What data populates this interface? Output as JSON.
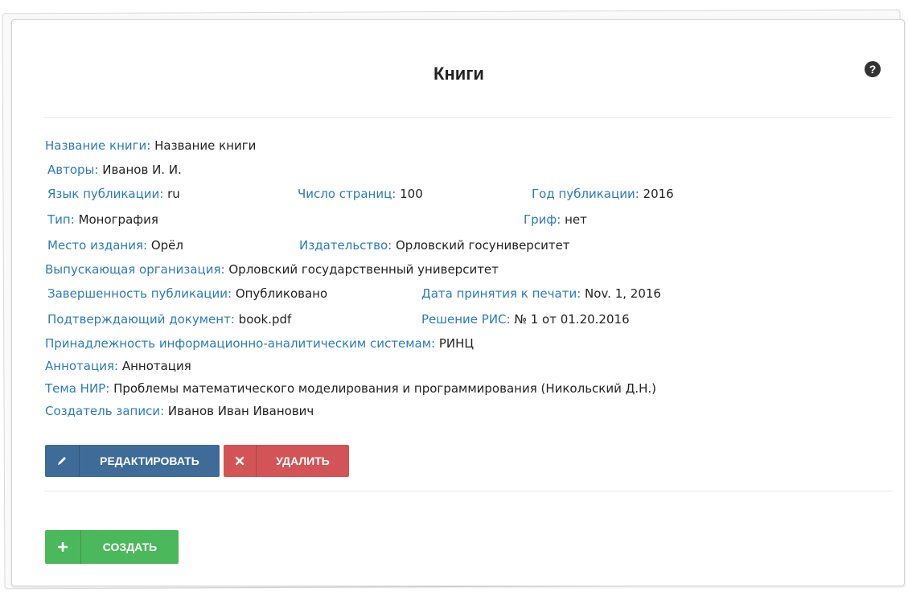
{
  "page": {
    "title": "Книги"
  },
  "fields": {
    "title": {
      "label": "Название книги:",
      "value": "Название книги"
    },
    "authors": {
      "label": "Авторы:",
      "value": "Иванов И. И."
    },
    "language": {
      "label": "Язык публикации:",
      "value": "ru"
    },
    "pages": {
      "label": "Число страниц:",
      "value": "100"
    },
    "year": {
      "label": "Год публикации:",
      "value": "2016"
    },
    "type": {
      "label": "Тип:",
      "value": "Монография"
    },
    "grif": {
      "label": "Гриф:",
      "value": "нет"
    },
    "place": {
      "label": "Место издания:",
      "value": "Орёл"
    },
    "publisher": {
      "label": "Издательство:",
      "value": "Орловский госуниверситет"
    },
    "issuing_org": {
      "label": "Выпускающая организация:",
      "value": "Орловский государственный университет"
    },
    "completeness": {
      "label": "Завершенность публикации:",
      "value": "Опубликовано"
    },
    "print_date": {
      "label": "Дата принятия к печати:",
      "value": "Nov. 1, 2016"
    },
    "document": {
      "label": "Подтверждающий документ:",
      "value": "book.pdf"
    },
    "ris": {
      "label": "Решение РИС:",
      "value": "№ 1 от 01.20.2016"
    },
    "systems": {
      "label": "Принадлежность информационно-аналитическим системам:",
      "value": "РИНЦ"
    },
    "annotation": {
      "label": "Аннотация:",
      "value": "Аннотация"
    },
    "research": {
      "label": "Тема НИР:",
      "value": "Проблемы математического моделирования и программирования (Никольский Д.Н.)"
    },
    "creator": {
      "label": "Создатель записи:",
      "value": "Иванов Иван Иванович"
    }
  },
  "buttons": {
    "edit": "РЕДАКТИРОВАТЬ",
    "delete": "УДАЛИТЬ",
    "create": "СОЗДАТЬ"
  },
  "icons": {
    "help": "question-circle-icon",
    "edit": "pencil-icon",
    "delete": "times-icon",
    "create": "plus-icon"
  },
  "colors": {
    "label": "#2a7bbd",
    "edit_button": "#3e6b97",
    "delete_button": "#d35456",
    "create_button": "#4cb85c"
  }
}
